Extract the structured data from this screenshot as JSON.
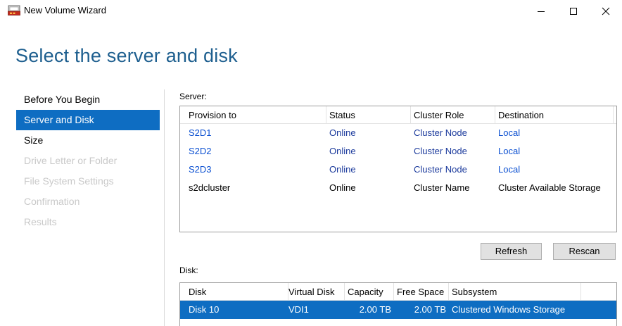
{
  "window": {
    "title": "New Volume Wizard",
    "icon": "volume-wizard-icon",
    "controls": [
      "minimize-icon",
      "maximize-icon",
      "close-icon"
    ]
  },
  "page_title": "Select the server and disk",
  "nav": {
    "items": [
      {
        "label": "Before You Begin",
        "state": "normal"
      },
      {
        "label": "Server and Disk",
        "state": "active"
      },
      {
        "label": "Size",
        "state": "normal"
      },
      {
        "label": "Drive Letter or Folder",
        "state": "disabled"
      },
      {
        "label": "File System Settings",
        "state": "disabled"
      },
      {
        "label": "Confirmation",
        "state": "disabled"
      },
      {
        "label": "Results",
        "state": "disabled"
      }
    ]
  },
  "server": {
    "label": "Server:",
    "columns": [
      "Provision to",
      "Status",
      "Cluster Role",
      "Destination"
    ],
    "rows": [
      {
        "provision_to": "S2D1",
        "status": "Online",
        "cluster_role": "Cluster Node",
        "destination": "Local"
      },
      {
        "provision_to": "S2D2",
        "status": "Online",
        "cluster_role": "Cluster Node",
        "destination": "Local"
      },
      {
        "provision_to": "S2D3",
        "status": "Online",
        "cluster_role": "Cluster Node",
        "destination": "Local"
      },
      {
        "provision_to": "s2dcluster",
        "status": "Online",
        "cluster_role": "Cluster Name",
        "destination": "Cluster Available Storage"
      }
    ]
  },
  "buttons": {
    "refresh": "Refresh",
    "rescan": "Rescan"
  },
  "disk": {
    "label": "Disk:",
    "columns": [
      "Disk",
      "Virtual Disk",
      "Capacity",
      "Free Space",
      "Subsystem"
    ],
    "rows": [
      {
        "disk": "Disk 10",
        "virtual_disk": "VDI1",
        "capacity": "2.00 TB",
        "free_space": "2.00 TB",
        "subsystem": "Clustered Windows Storage"
      }
    ]
  },
  "colors": {
    "accent": "#0e6dc2",
    "title": "#1e5f8f",
    "link": "#0a4fd1",
    "disabled": "#c9c9c9"
  }
}
